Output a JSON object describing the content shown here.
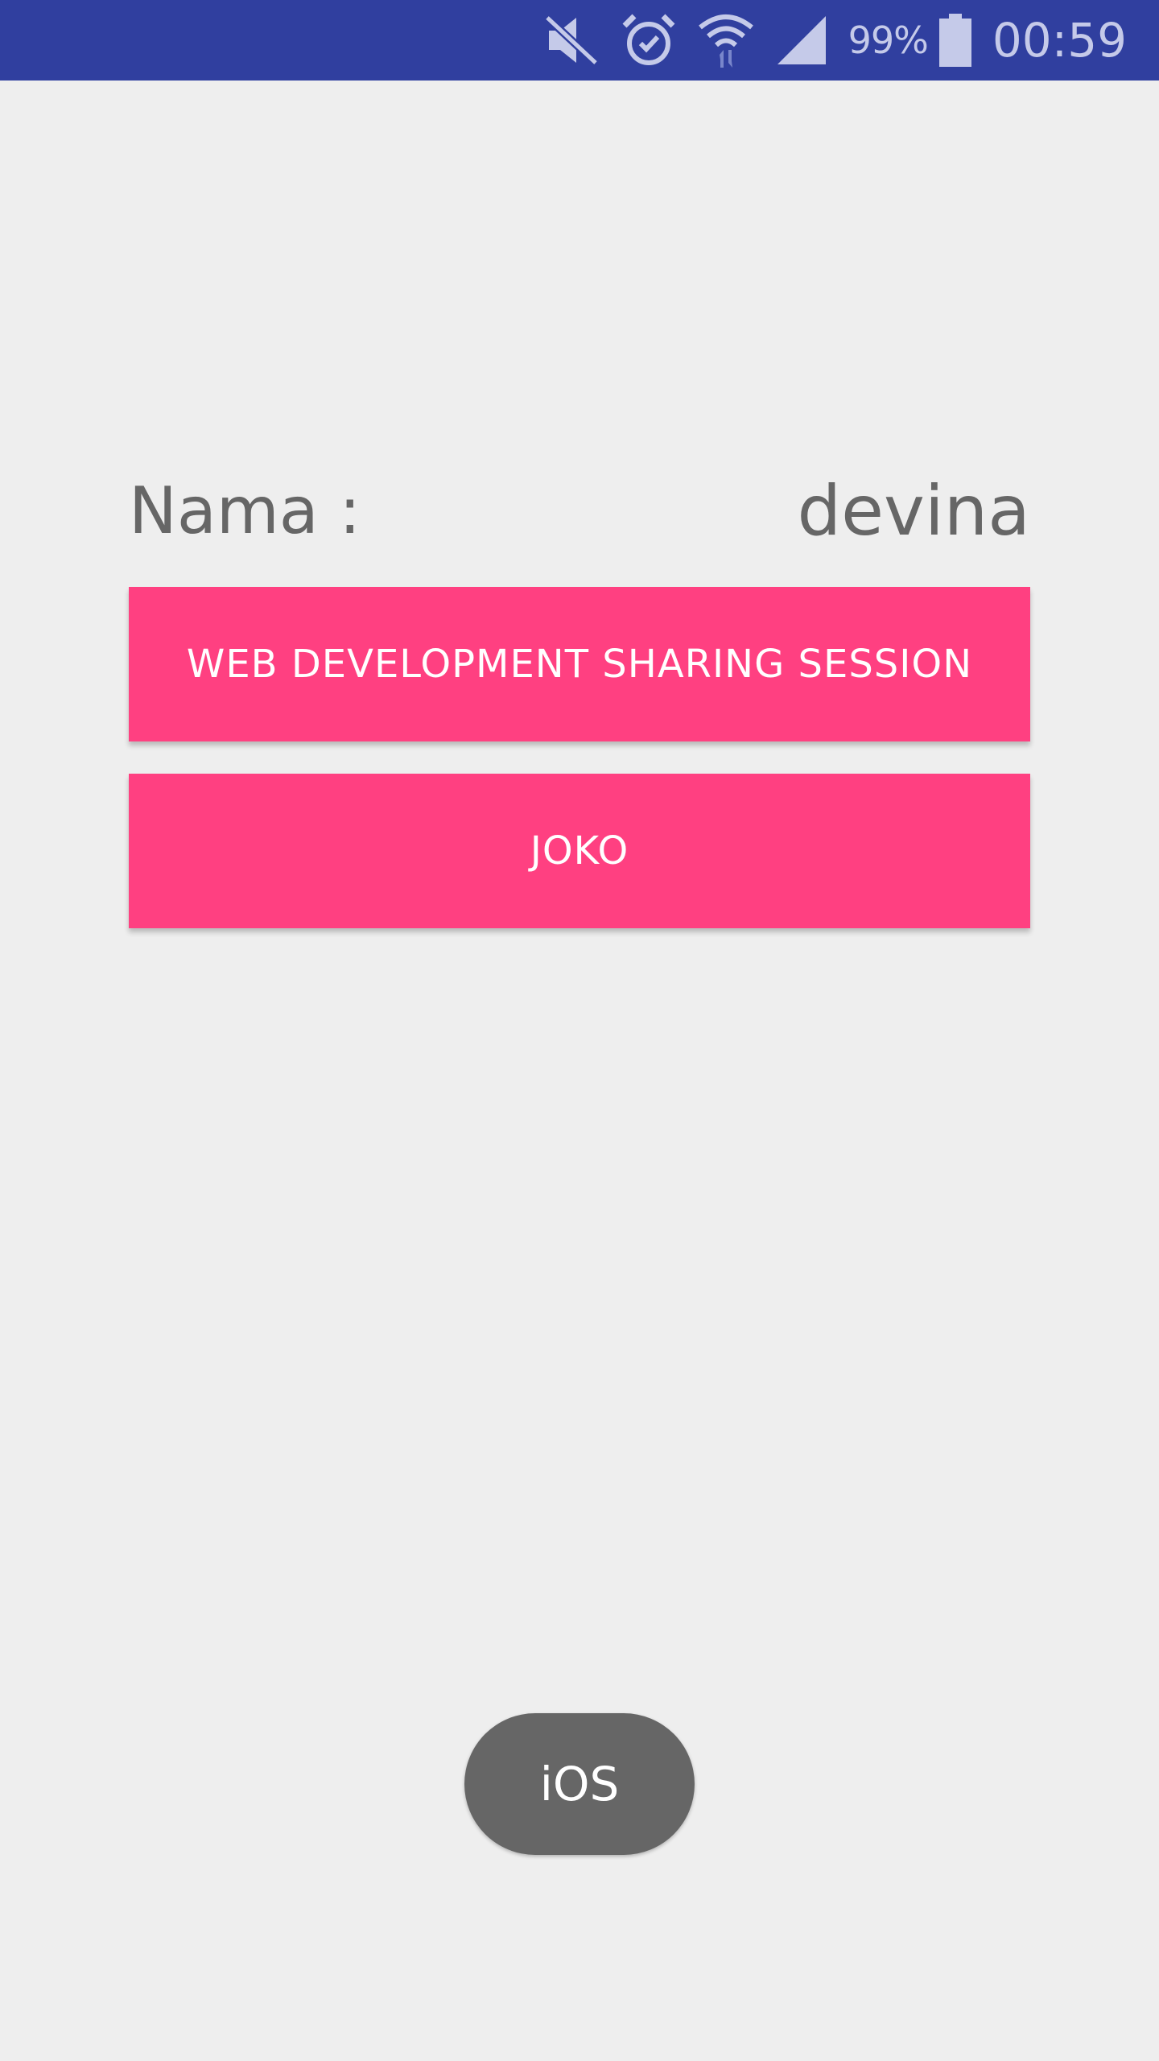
{
  "status_bar": {
    "battery_percent": "99%",
    "time": "00:59",
    "icons": [
      "mute-icon",
      "alarm-icon",
      "wifi-icon",
      "signal-icon",
      "battery-icon"
    ],
    "background": "#303f9f",
    "foreground": "#c5cae9"
  },
  "profile": {
    "label": "Nama :",
    "value": "devina"
  },
  "buttons": {
    "session": "WEB DEVELOPMENT SHARING SESSION",
    "joko": "JOKO",
    "color": "#ff4081"
  },
  "toast": {
    "text": "iOS"
  }
}
